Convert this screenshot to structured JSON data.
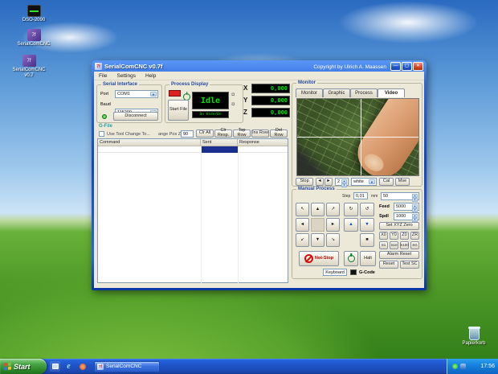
{
  "desktop": {
    "icons": [
      {
        "label": "DSO-2090"
      },
      {
        "label": "SerialComCNC"
      },
      {
        "label": "SerialComCNC v0.7"
      }
    ],
    "recycle_bin_label": "Papierkorb"
  },
  "window": {
    "title": "SerialComCNC  v0.7f",
    "copyright": "Copyright by Ulrich A. Maassen",
    "menu": [
      "File",
      "Settings",
      "Help"
    ],
    "serial_interface": {
      "title": "Serial Interface",
      "port_label": "Port",
      "port_value": "COM1",
      "baud_label": "Baud",
      "baud_value": "115200",
      "disconnect_label": "Disconnect"
    },
    "process_display": {
      "title": "Process Display",
      "start_file_label": "Start File",
      "status": "Idle",
      "sub_display": "On Hide/On",
      "axes": [
        {
          "label": "X",
          "value": "0,000"
        },
        {
          "label": "Y",
          "value": "0,000"
        },
        {
          "label": "Z",
          "value": "0,000"
        }
      ]
    },
    "gfile": {
      "title": "G-File",
      "tool_change_label": "Use Tool Change To...",
      "change_pos_label": "ange Pos Z",
      "change_pos_value": "90",
      "toolbar_buttons": [
        "Clr All",
        "Clr Resp.",
        "Top Row",
        "Ins Row",
        "Del Row"
      ],
      "table_headers": [
        "Command",
        "Sent",
        "Response"
      ]
    },
    "monitor": {
      "title": "Monitor",
      "tabs": [
        "Monitor",
        "Graphic",
        "Process",
        "Video"
      ],
      "stop_label": "Stop",
      "prev_label": "◄",
      "next_label": "►",
      "frame_value": "2",
      "color_value": "white",
      "cal_label": "Cal",
      "mse_label": "Mse"
    },
    "manual": {
      "title": "Manual Process",
      "step_label": "Step",
      "step_value": "0,01",
      "unit_label": "mm",
      "range_value": "50",
      "feed_label": "Feed",
      "feed_value": "5000",
      "spdl_label": "Spdl",
      "spdl_value": "1000",
      "set_xyz_label": "Set XYZ Zero",
      "zero_buttons": [
        "X0",
        "Y0",
        "Z0",
        "ZR"
      ],
      "step_buttons": [
        "S1",
        "S10",
        "S100",
        "SG"
      ],
      "alarm_reset_label": "Alarm Reset",
      "reset_label": "Reset",
      "test_sc_label": "Test SC",
      "not_stop_label": "Not-Stop",
      "halt_label": "Halt",
      "keyboard_label": "Keyboard",
      "gcode_label": "G-Code"
    }
  },
  "taskbar": {
    "start_label": "Start",
    "task_label": "SerialComCNC",
    "time": "17:56"
  }
}
